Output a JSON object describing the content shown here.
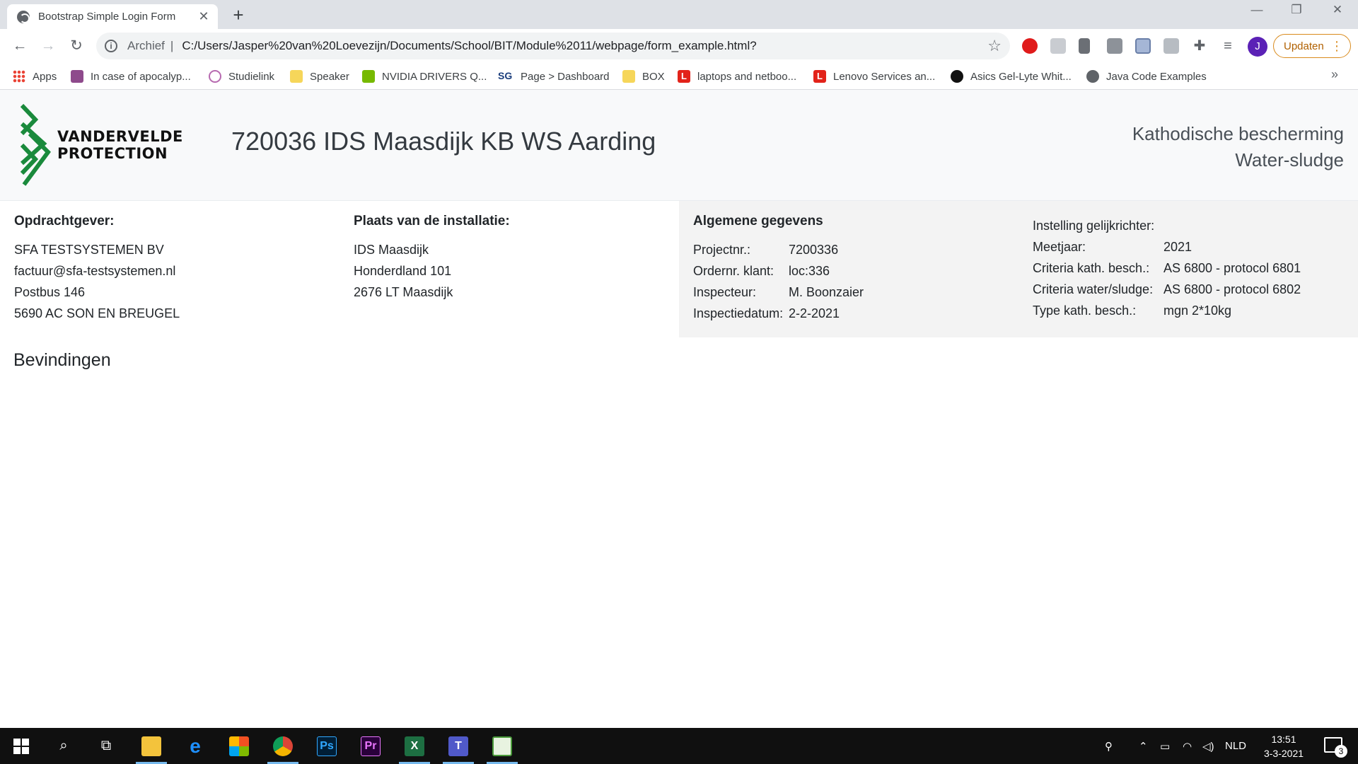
{
  "browser": {
    "tab_title": "Bootstrap Simple Login Form",
    "new_tab_symbol": "+",
    "omnibox_chip": "Archief",
    "url": "C:/Users/Jasper%20van%20Loevezijn/Documents/School/BIT/Module%2011/webpage/form_example.html?",
    "profile_initial": "J",
    "update_label": "Updaten",
    "bookmarks": [
      {
        "label": "Apps",
        "icon": "apps-grid-icon"
      },
      {
        "label": "In case of apocalyp...",
        "icon": "bookmark-favicon-icon"
      },
      {
        "label": "Studielink",
        "icon": "studielink-icon"
      },
      {
        "label": "Speaker",
        "icon": "folder-icon"
      },
      {
        "label": "NVIDIA DRIVERS Q...",
        "icon": "nvidia-icon"
      },
      {
        "label": "Page > Dashboard",
        "icon": "sg-icon"
      },
      {
        "label": "BOX",
        "icon": "folder-icon"
      },
      {
        "label": "laptops and netboo...",
        "icon": "lenovo-icon"
      },
      {
        "label": "Lenovo Services an...",
        "icon": "lenovo-icon"
      },
      {
        "label": "Asics Gel-Lyte Whit...",
        "icon": "asics-icon"
      },
      {
        "label": "Java Code Examples",
        "icon": "globe-icon"
      }
    ],
    "sg_text": "SG",
    "lenovo_text": "L"
  },
  "page": {
    "logo": {
      "line1": "VANDERVELDE",
      "line2": "PROTECTION"
    },
    "title": "720036 IDS Maasdijk KB WS Aarding",
    "subtitle_line1": "Kathodische bescherming",
    "subtitle_line2": "Water-sludge",
    "client": {
      "heading": "Opdrachtgever:",
      "lines": [
        "SFA TESTSYSTEMEN BV",
        "factuur@sfa-testsystemen.nl",
        "Postbus 146",
        "5690 AC SON EN BREUGEL"
      ]
    },
    "location": {
      "heading": "Plaats van de installatie:",
      "lines": [
        "IDS Maasdijk",
        "Honderdland 101",
        "2676 LT Maasdijk"
      ]
    },
    "general": {
      "heading": "Algemene gegevens",
      "rows": [
        {
          "label": "Projectnr.:",
          "value": "7200336"
        },
        {
          "label": "Ordernr. klant:",
          "value": "loc:336"
        },
        {
          "label": "Inspecteur:",
          "value": "M. Boonzaier"
        },
        {
          "label": "Inspectiedatum:",
          "value": "2-2-2021"
        }
      ]
    },
    "settings": {
      "heading": "Instelling gelijkrichter:",
      "rows": [
        {
          "label": "Meetjaar:",
          "value": "2021"
        },
        {
          "label": "Criteria kath. besch.:",
          "value": "AS 6800 - protocol 6801"
        },
        {
          "label": "Criteria water/sludge:",
          "value": "AS 6800 - protocol 6802"
        },
        {
          "label": "Type kath. besch.:",
          "value": "mgn 2*10kg"
        }
      ]
    },
    "section_title": "Bevindingen"
  },
  "taskbar": {
    "language": "NLD",
    "time": "13:51",
    "date": "3-3-2021",
    "notification_count": "3",
    "apps": [
      {
        "name": "file-explorer",
        "label": ""
      },
      {
        "name": "edge",
        "label": "e"
      },
      {
        "name": "store",
        "label": ""
      },
      {
        "name": "chrome",
        "label": ""
      },
      {
        "name": "photoshop",
        "label": "Ps"
      },
      {
        "name": "premiere",
        "label": "Pr"
      },
      {
        "name": "excel",
        "label": "X"
      },
      {
        "name": "teams",
        "label": "T"
      },
      {
        "name": "sheet-app",
        "label": ""
      }
    ]
  },
  "colors": {
    "brand_green": "#1a8a3c",
    "accent_update": "#d98a1c",
    "taskbar": "#101010"
  }
}
